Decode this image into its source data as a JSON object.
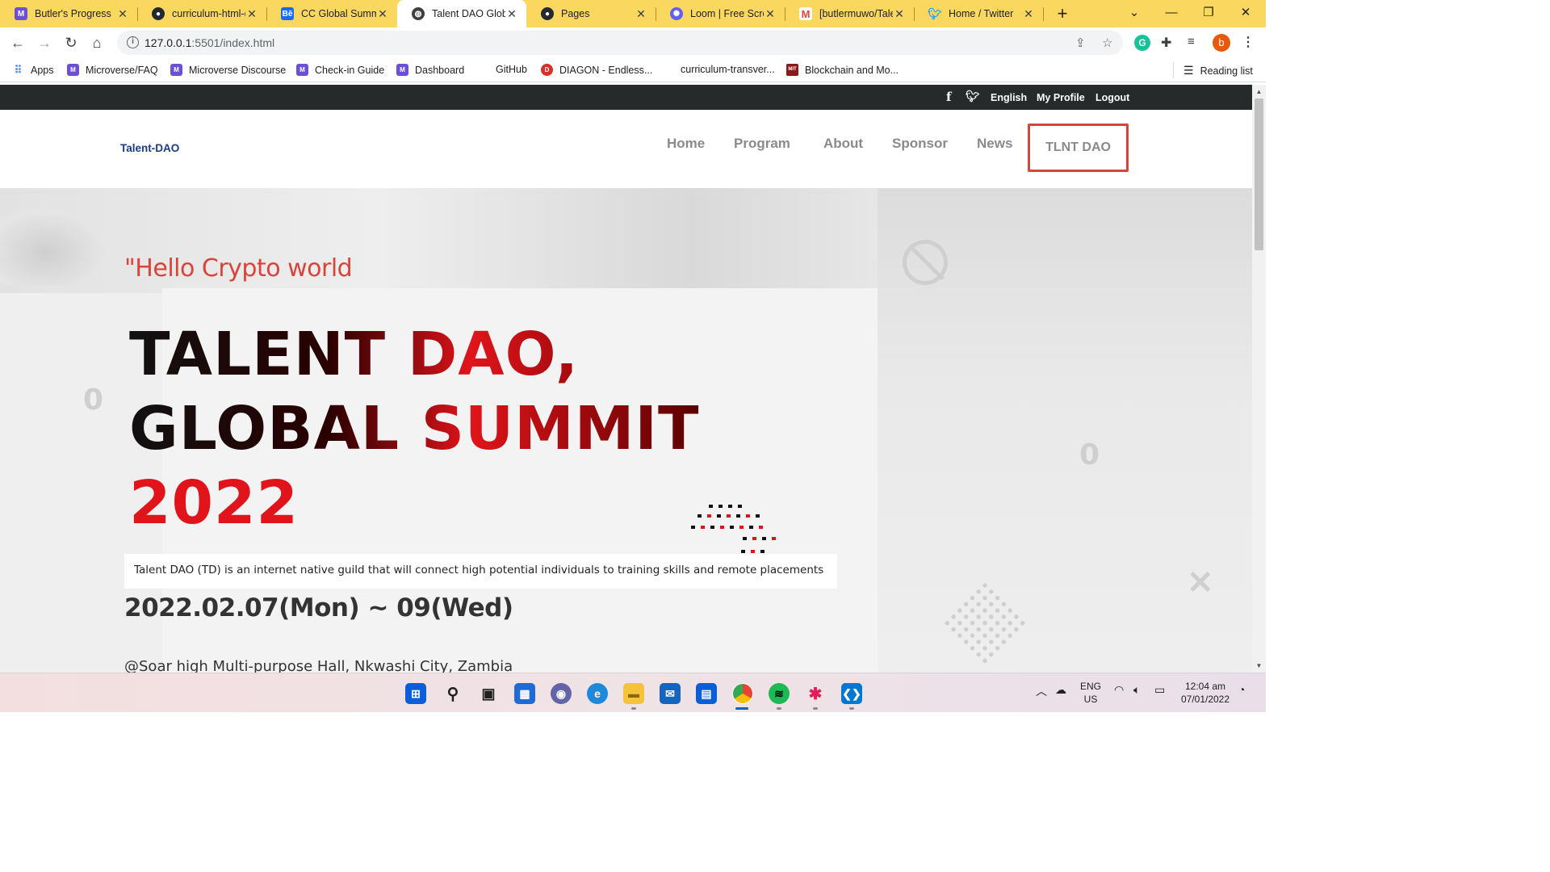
{
  "browser": {
    "tabs": [
      {
        "label": "Butler's Progress",
        "icon": "microverse-icon",
        "color": "#6b4fd6",
        "active": false
      },
      {
        "label": "curriculum-html-c",
        "icon": "github-icon",
        "color": "#24292f",
        "active": false
      },
      {
        "label": "CC Global Summ",
        "icon": "behance-icon",
        "color": "#1769ff",
        "active": false
      },
      {
        "label": "Talent DAO Globa",
        "icon": "globe-icon",
        "color": "#3c4043",
        "active": true
      },
      {
        "label": "Pages",
        "icon": "github-icon",
        "color": "#24292f",
        "active": false
      },
      {
        "label": "Loom | Free Scree",
        "icon": "loom-icon",
        "color": "#625df5",
        "active": false
      },
      {
        "label": "[butlermuwo/Tale",
        "icon": "gmail-icon",
        "color": "#ea4335",
        "active": false
      },
      {
        "label": "Home / Twitter",
        "icon": "twitter-icon",
        "color": "#1da1f2",
        "active": false
      }
    ],
    "url_host": "127.0.0.1",
    "url_path": ":5501/index.html",
    "profile_initial": "b",
    "bookmarks": [
      {
        "label": "Apps",
        "icon": "apps-grid-icon"
      },
      {
        "label": "Microverse/FAQ",
        "icon": "microverse-icon"
      },
      {
        "label": "Microverse Discourse",
        "icon": "microverse-icon"
      },
      {
        "label": "Check-in Guide",
        "icon": "microverse-icon"
      },
      {
        "label": "Dashboard",
        "icon": "microverse-icon"
      },
      {
        "label": "GitHub",
        "icon": "github-icon"
      },
      {
        "label": "DIAGON - Endless...",
        "icon": "diagon-icon"
      },
      {
        "label": "curriculum-transver...",
        "icon": "github-icon"
      },
      {
        "label": "Blockchain and Mo...",
        "icon": "mit-icon"
      }
    ],
    "reading_list": "Reading list"
  },
  "site": {
    "topbar": {
      "language": "English",
      "profile": "My Profile",
      "logout": "Logout"
    },
    "logo": "Talent-DAO",
    "nav": [
      "Home",
      "Program",
      "About",
      "Sponsor",
      "News"
    ],
    "nav_cta": "TLNT DAO",
    "hero": {
      "greeting": "\"Hello Crypto world",
      "headline_1": "TALENT DAO,",
      "headline_2": "GLOBAL SUMMIT",
      "headline_3": "2022",
      "intro": "Talent DAO (TD) is an internet native guild that will connect high potential individuals to training skills and remote placements",
      "dates": "2022.02.07(Mon) ~ 09(Wed)",
      "venue": "@Soar high Multi-purpose Hall, Nkwashi City, Zambia"
    },
    "accent_color": "#d9443a"
  },
  "taskbar": {
    "lang_1": "ENG",
    "lang_2": "US",
    "time": "12:04 am",
    "date": "07/01/2022"
  }
}
